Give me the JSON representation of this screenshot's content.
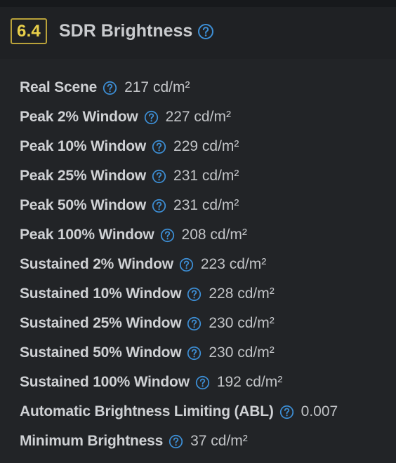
{
  "section": {
    "score": "6.4",
    "title": "SDR Brightness",
    "help_icon": "question-circle-icon",
    "accent_color": "#e8cf4a",
    "help_color": "#3d8fd6"
  },
  "rows": [
    {
      "label": "Real Scene",
      "value": "217 cd/m²"
    },
    {
      "label": "Peak 2% Window",
      "value": "227 cd/m²"
    },
    {
      "label": "Peak 10% Window",
      "value": "229 cd/m²"
    },
    {
      "label": "Peak 25% Window",
      "value": "231 cd/m²"
    },
    {
      "label": "Peak 50% Window",
      "value": "231 cd/m²"
    },
    {
      "label": "Peak 100% Window",
      "value": "208 cd/m²"
    },
    {
      "label": "Sustained 2% Window",
      "value": "223 cd/m²"
    },
    {
      "label": "Sustained 10% Window",
      "value": "228 cd/m²"
    },
    {
      "label": "Sustained 25% Window",
      "value": "230 cd/m²"
    },
    {
      "label": "Sustained 50% Window",
      "value": "230 cd/m²"
    },
    {
      "label": "Sustained 100% Window",
      "value": "192 cd/m²"
    },
    {
      "label": "Automatic Brightness Limiting (ABL)",
      "value": "0.007"
    },
    {
      "label": "Minimum Brightness",
      "value": "37 cd/m²"
    }
  ]
}
